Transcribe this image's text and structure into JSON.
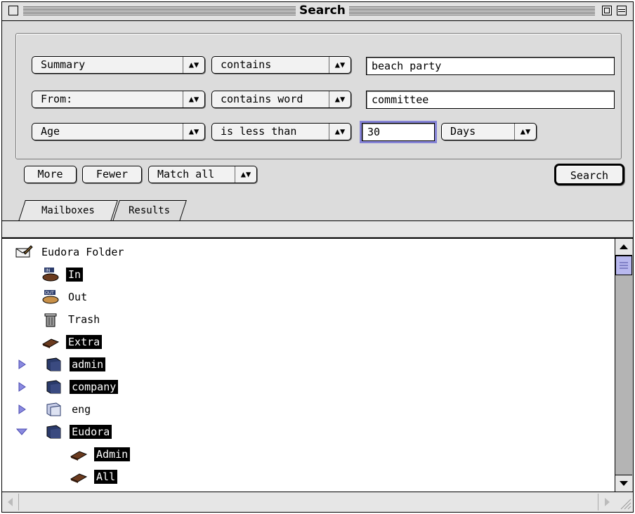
{
  "window": {
    "title": "Search"
  },
  "criteria": [
    {
      "field": "Summary",
      "operator": "contains",
      "value": "beach party"
    },
    {
      "field": "From:",
      "operator": "contains word",
      "value": "committee"
    },
    {
      "field": "Age",
      "operator": "is less than",
      "value": "30",
      "unit": "Days"
    }
  ],
  "controls": {
    "more": "More",
    "fewer": "Fewer",
    "match": "Match all",
    "search": "Search"
  },
  "tabs": [
    {
      "label": "Mailboxes"
    },
    {
      "label": "Results"
    }
  ],
  "mailboxes": {
    "root": "Eudora Folder",
    "items": [
      {
        "label": "In",
        "selected": true,
        "icon": "in-mailbox-icon"
      },
      {
        "label": "Out",
        "selected": false,
        "icon": "out-mailbox-icon"
      },
      {
        "label": "Trash",
        "selected": false,
        "icon": "trash-icon"
      },
      {
        "label": "Extra",
        "selected": true,
        "icon": "mailbox-icon"
      },
      {
        "label": "admin",
        "selected": true,
        "icon": "folder-icon",
        "disclosure": "collapsed"
      },
      {
        "label": "company",
        "selected": true,
        "icon": "folder-icon",
        "disclosure": "collapsed"
      },
      {
        "label": "eng",
        "selected": false,
        "icon": "folder-icon",
        "disclosure": "collapsed"
      },
      {
        "label": "Eudora",
        "selected": true,
        "icon": "folder-icon",
        "disclosure": "expanded"
      },
      {
        "label": "Admin",
        "selected": true,
        "icon": "mailbox-icon"
      },
      {
        "label": "All",
        "selected": true,
        "icon": "mailbox-icon"
      }
    ]
  },
  "colors": {
    "focus_ring": "#8583d6",
    "disclosure": "#6f6fd8",
    "mailbox_brown": "#6a3a1e",
    "folder_navy": "#2a3a6a"
  }
}
